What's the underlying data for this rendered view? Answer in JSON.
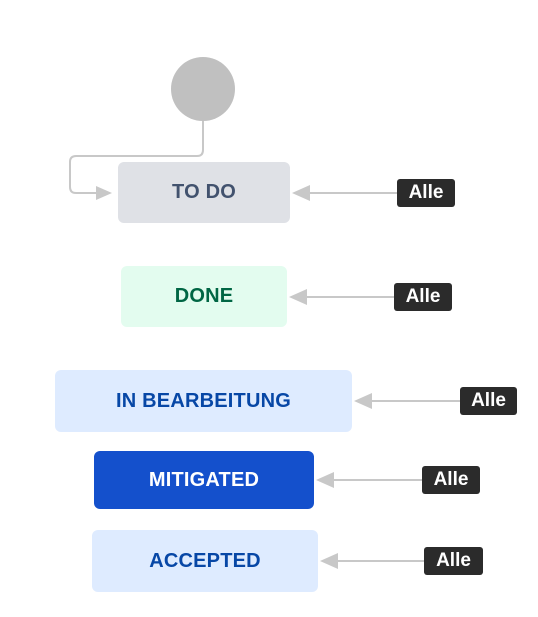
{
  "workflow": {
    "start_node": {
      "color": "#c0c0c0"
    },
    "statuses": [
      {
        "label": "TO DO",
        "bg": "#dfe1e6",
        "fg": "#42526e",
        "transition_label": "Alle"
      },
      {
        "label": "DONE",
        "bg": "#e3fcef",
        "fg": "#006644",
        "transition_label": "Alle"
      },
      {
        "label": "IN BEARBEITUNG",
        "bg": "#deebff",
        "fg": "#0747a6",
        "transition_label": "Alle"
      },
      {
        "label": "MITIGATED",
        "bg": "#1450cc",
        "fg": "#ffffff",
        "transition_label": "Alle"
      },
      {
        "label": "ACCEPTED",
        "bg": "#deebff",
        "fg": "#0747a6",
        "transition_label": "Alle"
      }
    ],
    "connector_color": "#c8c8c8"
  }
}
